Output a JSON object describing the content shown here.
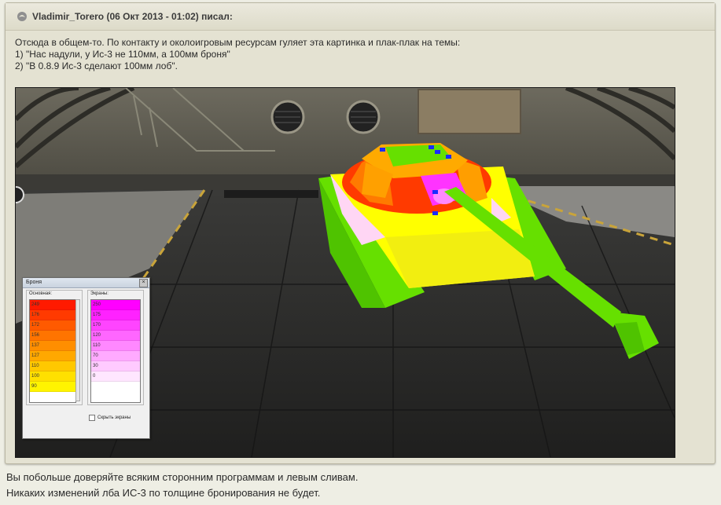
{
  "quote": {
    "author_line": "Vladimir_Torero (06 Окт 2013 - 01:02) писал:",
    "lines": [
      "Отсюда в общем-то. По контакту и околоигровым ресурсам гуляет эта картинка и плак-плак на темы:",
      "1) \"Нас надули, у Ис-3 не 110мм, а 100мм броня\"",
      "2) \"В 0.8.9 Ис-3 сделают 100мм лоб\"."
    ]
  },
  "armor_window": {
    "title": "Броня",
    "main_label": "Основная:",
    "screens_label": "Экраны:",
    "main_values": [
      "249",
      "176",
      "172",
      "156",
      "137",
      "127",
      "110",
      "100",
      "90"
    ],
    "main_colors": [
      "#ff1a00",
      "#ff3a00",
      "#ff5a00",
      "#ff7400",
      "#ff8e00",
      "#ffa800",
      "#ffc800",
      "#ffe000",
      "#fff400"
    ],
    "screen_values": [
      "250",
      "175",
      "170",
      "120",
      "110",
      "70",
      "30",
      "0"
    ],
    "screen_colors": [
      "#ff00ff",
      "#ff22ff",
      "#ff44ff",
      "#ff66ff",
      "#ff88ff",
      "#ffaaff",
      "#ffcaff",
      "#ffe6ff"
    ],
    "hide_screens_label": "Скрыть экраны"
  },
  "reply": {
    "lines": [
      "Вы побольше доверяйте всяким сторонним программам и левым сливам.",
      "Никаких изменений лба ИС-3 по толщине бронирования не будет."
    ]
  }
}
